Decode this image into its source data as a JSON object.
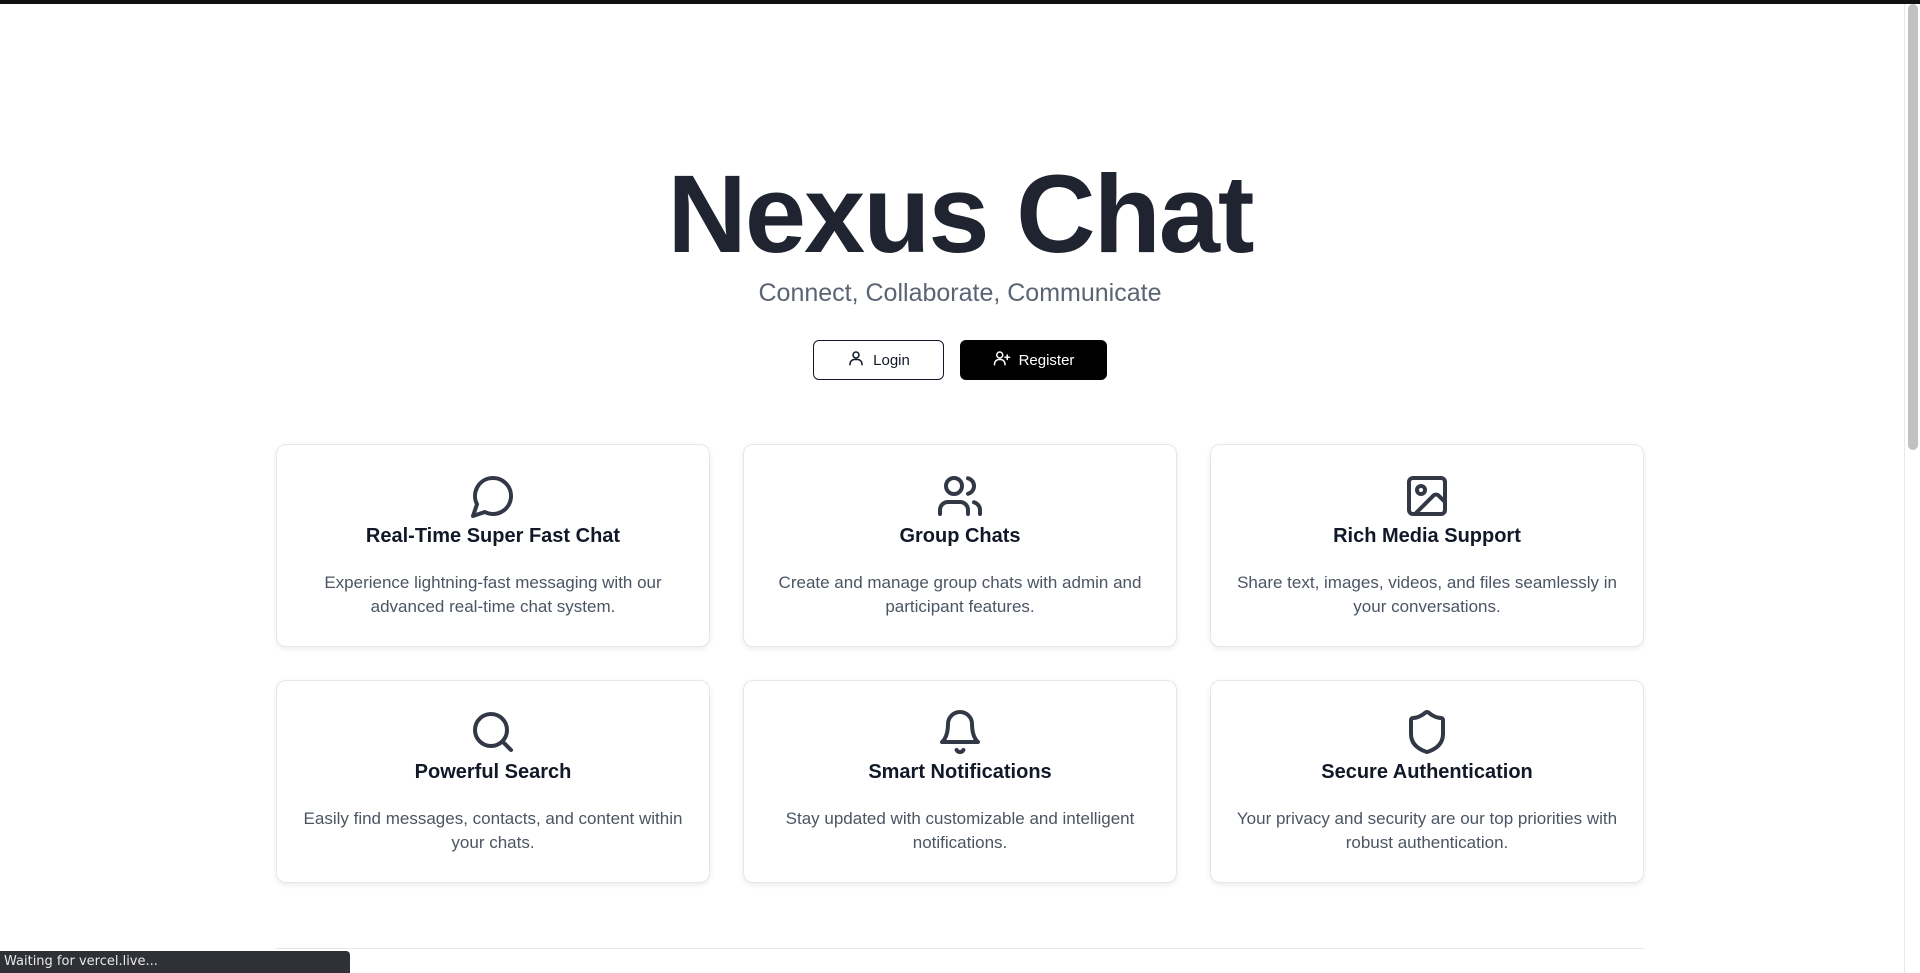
{
  "hero": {
    "title": "Nexus Chat",
    "subtitle": "Connect, Collaborate, Communicate"
  },
  "actions": {
    "login_label": "Login",
    "login_icon": "user-icon",
    "register_label": "Register",
    "register_icon": "user-plus-icon"
  },
  "features": [
    {
      "icon": "message-circle-icon",
      "title": "Real-Time Super Fast Chat",
      "description": "Experience lightning-fast messaging with our advanced real-time chat system."
    },
    {
      "icon": "users-icon",
      "title": "Group Chats",
      "description": "Create and manage group chats with admin and participant features."
    },
    {
      "icon": "image-icon",
      "title": "Rich Media Support",
      "description": "Share text, images, videos, and files seamlessly in your conversations."
    },
    {
      "icon": "search-icon",
      "title": "Powerful Search",
      "description": "Easily find messages, contacts, and content within your chats."
    },
    {
      "icon": "bell-icon",
      "title": "Smart Notifications",
      "description": "Stay updated with customizable and intelligent notifications."
    },
    {
      "icon": "shield-icon",
      "title": "Secure Authentication",
      "description": "Your privacy and security are our top priorities with robust authentication."
    }
  ],
  "browser": {
    "status_text": "Waiting for vercel.live..."
  },
  "colors": {
    "title": "#1f2430",
    "subtitle": "#5b6473",
    "primary_button": "#000000",
    "icon_stroke": "#323846"
  }
}
